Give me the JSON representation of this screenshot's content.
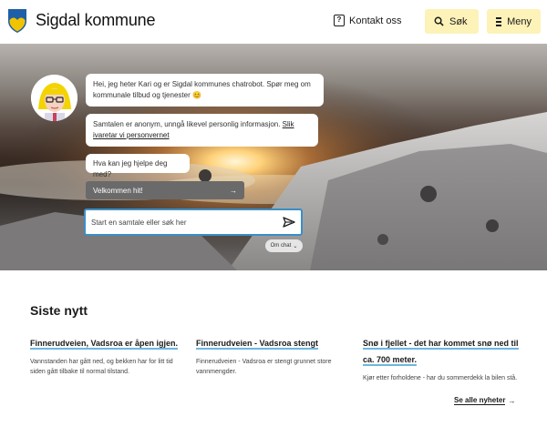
{
  "header": {
    "brand": "Sigdal kommune",
    "contact_label": "Kontakt oss",
    "search_label": "Søk",
    "menu_label": "Meny"
  },
  "chat": {
    "intro": "Hei, jeg heter Kari og er Sigdal kommunes chatrobot. Spør meg om kommunale tilbud og tjenester 😊",
    "privacy_text": "Samtalen er anonym, unngå likevel personlig informasjon. ",
    "privacy_link": "Slik ivaretar vi personvernet",
    "question": "Hva kan jeg hjelpe deg med?",
    "welcome_button": "Velkommen hit!",
    "input_placeholder": "Start en samtale eller søk her",
    "about_chat": "Om chat"
  },
  "news": {
    "title": "Siste nytt",
    "items": [
      {
        "headline": "Finnerudveien, Vadsroa er åpen igjen.",
        "text": "Vannstanden har gått ned, og bekken har for litt tid siden gått tilbake til normal tilstand."
      },
      {
        "headline": "Finnerudveien - Vadsroa stengt",
        "text": "Finnerudveien - Vadsroa er stengt grunnet store vannmengder."
      },
      {
        "headline": "Snø i fjellet - det har kommet snø ned til ca. 700 meter.",
        "text": "Kjør etter forholdene - har du sommerdekk la bilen stå."
      }
    ],
    "see_all": "Se alle nyheter"
  },
  "colors": {
    "accent_yellow": "#fdf2b8",
    "link_underline": "#6fb6df",
    "input_border": "#3b8ec6"
  }
}
